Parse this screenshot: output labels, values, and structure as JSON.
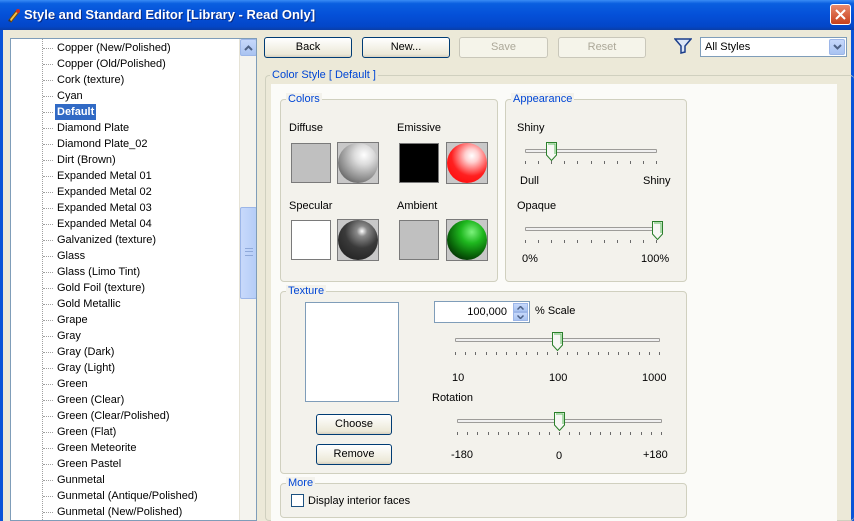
{
  "window": {
    "title": "Style and Standard Editor [Library - Read Only]",
    "close_glyph": "✕"
  },
  "style_list": {
    "items": [
      "Copper (New/Polished)",
      "Copper (Old/Polished)",
      "Cork (texture)",
      "Cyan",
      "Default",
      "Diamond Plate",
      "Diamond Plate_02",
      "Dirt (Brown)",
      "Expanded Metal 01",
      "Expanded Metal 02",
      "Expanded Metal 03",
      "Expanded Metal 04",
      "Galvanized (texture)",
      "Glass",
      "Glass (Limo Tint)",
      "Gold Foil (texture)",
      "Gold Metallic",
      "Grape",
      "Gray",
      "Gray (Dark)",
      "Gray (Light)",
      "Green",
      "Green (Clear)",
      "Green (Clear/Polished)",
      "Green (Flat)",
      "Green Meteorite",
      "Green Pastel",
      "Gunmetal",
      "Gunmetal (Antique/Polished)",
      "Gunmetal (New/Polished)"
    ],
    "selected": "Default"
  },
  "toolbar": {
    "back": "Back",
    "new": "New...",
    "save": "Save",
    "reset": "Reset",
    "filter_icon": "funnel-icon",
    "filter_value": "All Styles"
  },
  "color_style": {
    "legend": "Color Style [ Default ]",
    "colors": {
      "legend": "Colors",
      "diffuse": {
        "label": "Diffuse",
        "color": "#c0c0c0"
      },
      "emissive": {
        "label": "Emissive",
        "color": "#000000"
      },
      "specular": {
        "label": "Specular",
        "color": "#ffffff"
      },
      "ambient": {
        "label": "Ambient",
        "color": "#c0c0c0"
      }
    },
    "appearance": {
      "legend": "Appearance",
      "shiny": {
        "label": "Shiny",
        "min": "Dull",
        "max": "Shiny",
        "value": 0.2
      },
      "opaque": {
        "label": "Opaque",
        "min": "0%",
        "max": "100%",
        "value": 1.0
      }
    },
    "texture": {
      "legend": "Texture",
      "scale_value": "100,000",
      "scale_label": "% Scale",
      "scale_ticks": [
        "10",
        "100",
        "1000"
      ],
      "scale_slider": 0.5,
      "rotation_label": "Rotation",
      "rotation_ticks": [
        "-180",
        "0",
        "+180"
      ],
      "rotation_slider": 0.5,
      "choose": "Choose",
      "remove": "Remove"
    },
    "more": {
      "legend": "More",
      "display_interior_faces": "Display interior faces",
      "display_interior_faces_checked": false
    }
  }
}
